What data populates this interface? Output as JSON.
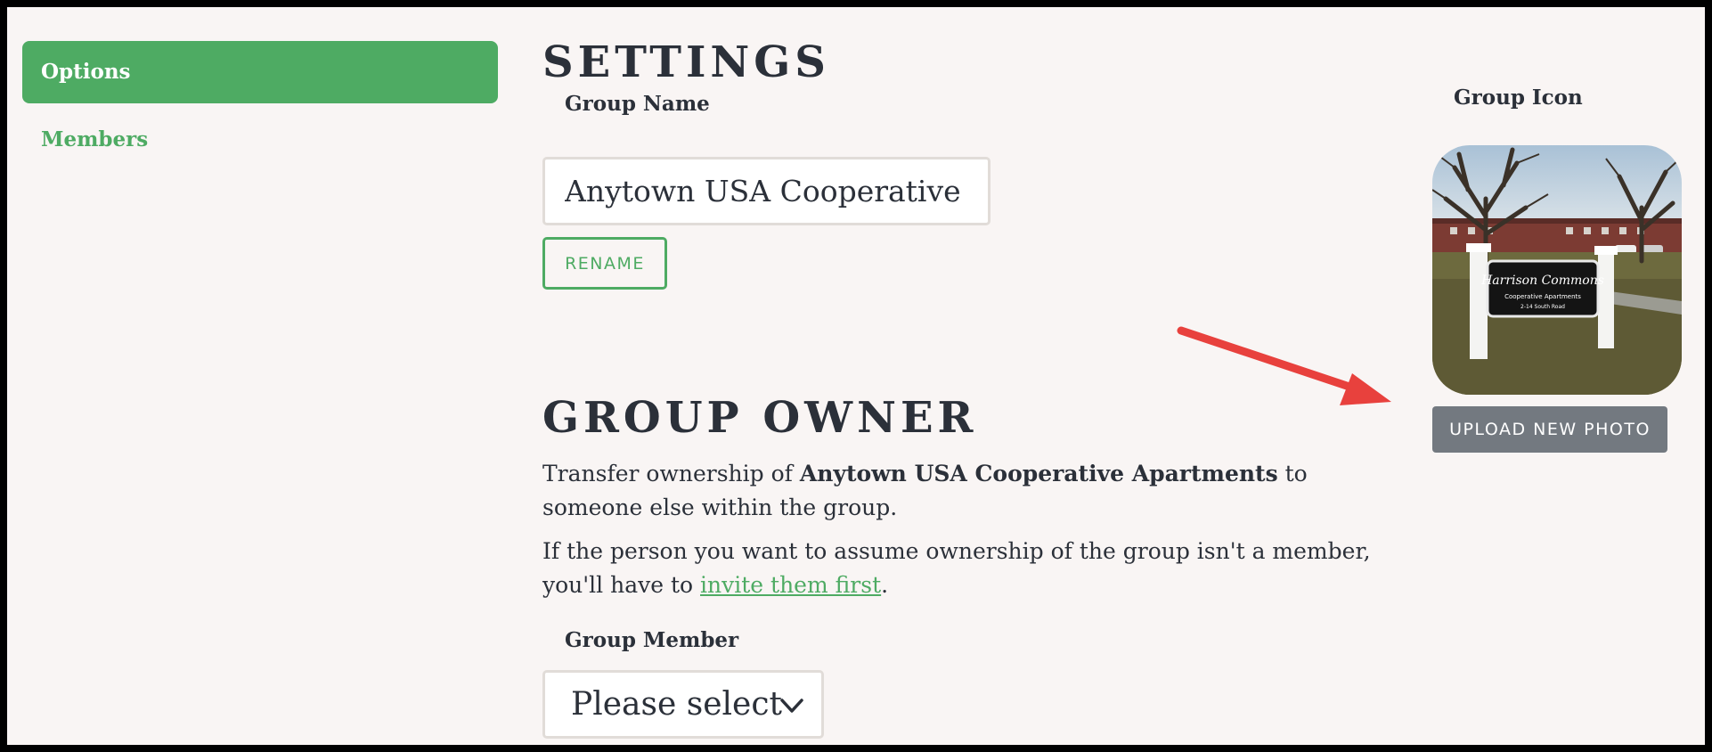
{
  "sidebar": {
    "items": [
      {
        "label": "Options",
        "active": true
      },
      {
        "label": "Members",
        "active": false
      }
    ]
  },
  "settings": {
    "title": "SETTINGS",
    "group_name_label": "Group Name",
    "group_name_value": "Anytown USA Cooperative Apartments",
    "rename_label": "RENAME"
  },
  "group_icon": {
    "label": "Group Icon",
    "photo_sign_title": "Harrison Commons",
    "photo_sign_subtitle": "Cooperative Apartments",
    "photo_sign_address": "2-14 South Road",
    "upload_label": "UPLOAD NEW PHOTO"
  },
  "owner": {
    "title": "GROUP OWNER",
    "transfer_prefix": "Transfer ownership of ",
    "transfer_group": "Anytown USA Cooperative Apartments",
    "transfer_suffix": " to someone else within the group.",
    "invite_prefix": "If the person you want to assume ownership of the group isn't a member, you'll have to ",
    "invite_link": "invite them first",
    "invite_suffix": ".",
    "member_label": "Group Member",
    "member_select_value": "Please select"
  },
  "colors": {
    "accent": "#4eab63",
    "background": "#f9f5f4",
    "text": "#2b3039",
    "upload_button": "#737980",
    "annotation_arrow": "#e8413d"
  },
  "icons": {
    "select_chevron": "chevron-down-icon",
    "annotation": "red-arrow-annotation"
  }
}
